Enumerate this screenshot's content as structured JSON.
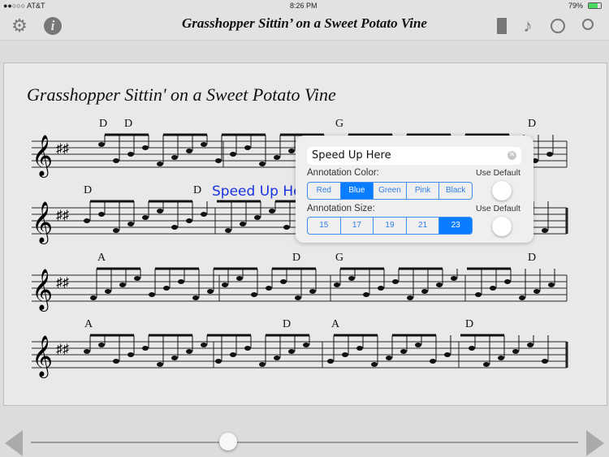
{
  "status": {
    "carrier": "●●○○○ AT&T",
    "time": "8:26 PM",
    "battery": "79%"
  },
  "nav": {
    "title": "Grasshopper Sittin’ on a Sweet Potato Vine",
    "icons": [
      "gear-icon",
      "info-icon",
      "book-icon",
      "music-note-icon",
      "clock-icon",
      "search-icon"
    ]
  },
  "sheet": {
    "title": "Grasshopper Sittin' on a Sweet Potato Vine",
    "annotation": "Speed Up Here",
    "chords": [
      [
        "D",
        "D",
        "G",
        "D"
      ],
      [
        "D",
        "D"
      ],
      [
        "A",
        "D",
        "G",
        "D"
      ],
      [
        "A",
        "D",
        "A",
        "D"
      ]
    ]
  },
  "popover": {
    "text": "Speed Up Here",
    "color_label": "Annotation Color:",
    "size_label": "Annotation Size:",
    "use_default": "Use Default",
    "colors": [
      "Red",
      "Blue",
      "Green",
      "Pink",
      "Black"
    ],
    "selected_color": "Blue",
    "sizes": [
      "15",
      "17",
      "19",
      "21",
      "23"
    ],
    "selected_size": "23",
    "accent": "#0a7cff"
  },
  "slider": {
    "position": 0.36
  }
}
